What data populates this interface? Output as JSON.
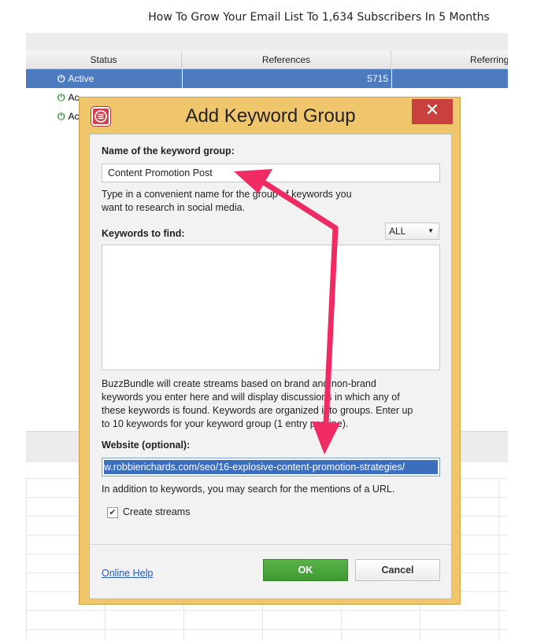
{
  "caption": "How To Grow Your Email List To 1,634 Subscribers In 5 Months",
  "background_table": {
    "columns": [
      "Status",
      "References",
      "Referring A"
    ],
    "rows": [
      {
        "status": "Active",
        "references": "5715",
        "selected": true
      },
      {
        "status": "Ac",
        "references": "",
        "selected": false
      },
      {
        "status": "Ac",
        "references": "",
        "selected": false
      }
    ]
  },
  "dialog": {
    "title": "Add Keyword Group",
    "close_label": "✕",
    "name_label": "Name of the keyword group:",
    "name_value": "Content Promotion Post",
    "name_hint_line1": "Type in a convenient name for the group of keywords you",
    "name_hint_line2": "want to research in social media.",
    "keywords_label": "Keywords to find:",
    "keywords_filter": "ALL",
    "keywords_hint_line1": "BuzzBundle will create streams based on brand and non-brand",
    "keywords_hint_line2": "keywords you enter here and will display discussions in which any of",
    "keywords_hint_line3": "these keywords is found. Keywords are organized into groups. Enter up",
    "keywords_hint_line4": "to 10 keywords for your keyword group (1 entry per line).",
    "website_label": "Website (optional):",
    "website_value": "w.robbierichards.com/seo/16-explosive-content-promotion-strategies/",
    "website_hint": "In addition to keywords, you may search for the mentions of a URL.",
    "create_streams_label": "Create streams",
    "create_streams_checked": true,
    "help_label": "Online Help",
    "ok_label": "OK",
    "cancel_label": "Cancel"
  },
  "colors": {
    "dialog_frame": "#f0c66c",
    "close_button": "#c9413f",
    "ok_button": "#4aa63d",
    "selection": "#3b6ebd",
    "arrow": "#ee2b62"
  },
  "icons": {
    "app_icon": "buzzbundle-logo-icon",
    "status_icon": "power-icon",
    "check_icon": "checkmark-icon",
    "dropdown_icon": "caret-down-icon"
  }
}
